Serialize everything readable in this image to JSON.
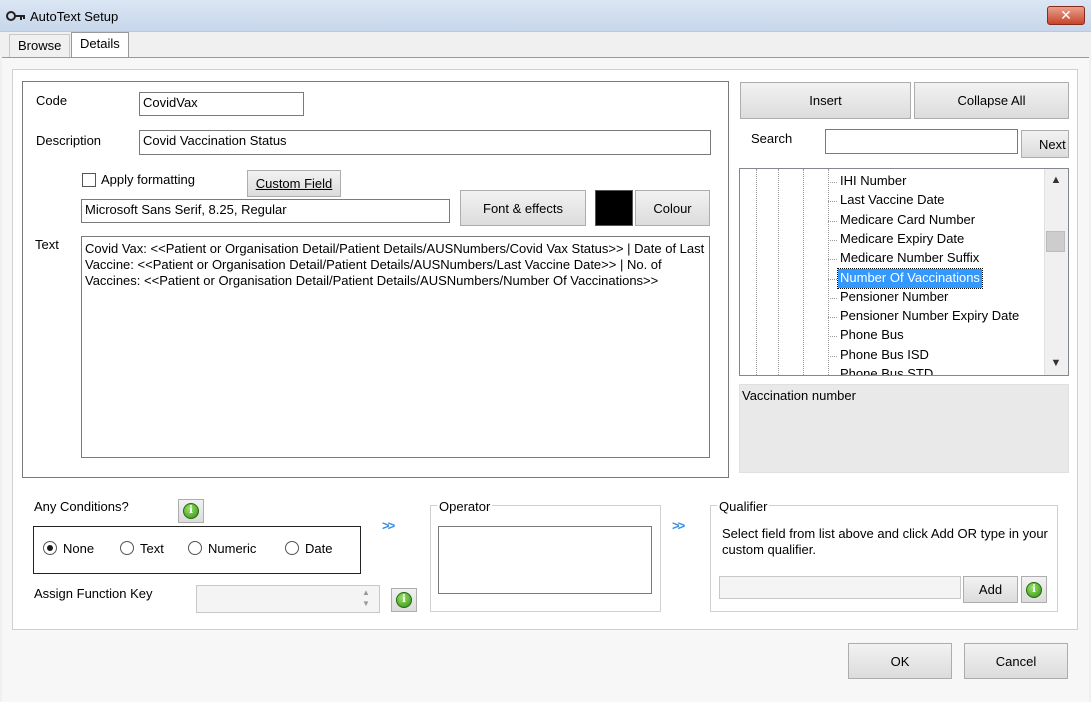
{
  "window": {
    "title": "AutoText Setup",
    "close_label": "✕"
  },
  "tabs": [
    {
      "label": "Browse",
      "active": false
    },
    {
      "label": "Details",
      "active": true
    }
  ],
  "form": {
    "code_label": "Code",
    "code_value": "CovidVax",
    "description_label": "Description",
    "description_value": "Covid Vaccination Status",
    "apply_formatting_label": "Apply formatting",
    "apply_formatting_checked": false,
    "custom_field_label": "Custom Field",
    "font_value": "Microsoft Sans Serif, 8.25, Regular",
    "font_effects_label": "Font & effects",
    "colour_label": "Colour",
    "colour_swatch": "#000000",
    "text_label": "Text",
    "text_value": "Covid Vax: <<Patient or Organisation Detail/Patient Details/AUSNumbers/Covid Vax Status>> | Date of Last Vaccine: <<Patient or Organisation Detail/Patient Details/AUSNumbers/Last Vaccine Date>> | No. of Vaccines: <<Patient or Organisation Detail/Patient Details/AUSNumbers/Number Of Vaccinations>>"
  },
  "right_panel": {
    "insert_label": "Insert",
    "collapse_all_label": "Collapse All",
    "search_label": "Search",
    "search_value": "",
    "next_label": "Next",
    "tree_items": [
      "IHI Number",
      "Last Vaccine Date",
      "Medicare Card Number",
      "Medicare Expiry Date",
      "Medicare Number Suffix",
      "Number Of Vaccinations",
      "Pensioner Number",
      "Pensioner Number Expiry Date",
      "Phone Bus",
      "Phone Bus ISD",
      "Phone Bus STD"
    ],
    "selected_index": 5,
    "field_description": "Vaccination number"
  },
  "conditions": {
    "label": "Any Conditions?",
    "options": [
      "None",
      "Text",
      "Numeric",
      "Date"
    ],
    "selected": "None",
    "arrow_text": ">>",
    "operator_label": "Operator",
    "qualifier_label": "Qualifier",
    "qualifier_hint": "Select field from list above and click Add OR type in your custom qualifier.",
    "add_label": "Add",
    "assign_function_key_label": "Assign Function Key",
    "info_glyph": "i"
  },
  "footer": {
    "ok_label": "OK",
    "cancel_label": "Cancel"
  },
  "icons": {
    "title_icon": "key-icon",
    "info_icon": "green-info-icon"
  }
}
